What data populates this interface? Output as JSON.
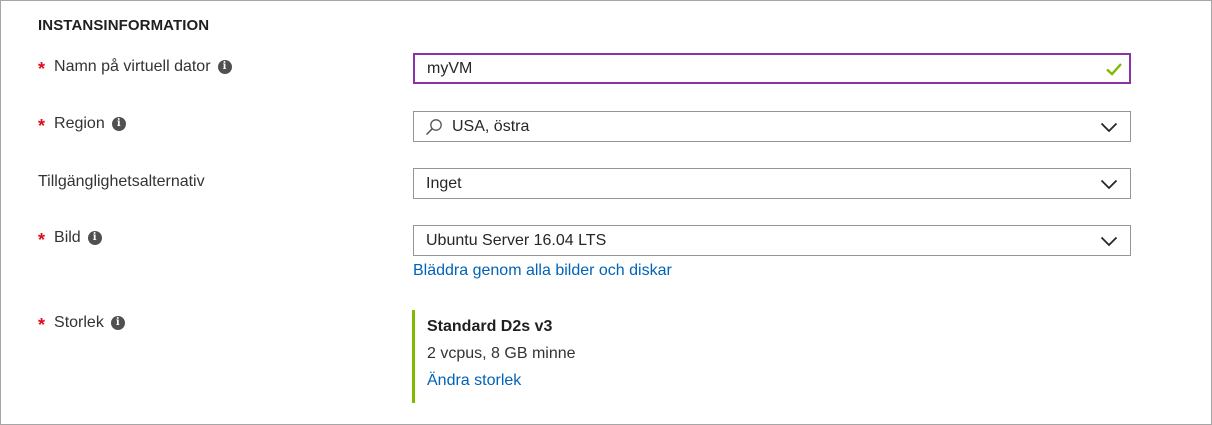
{
  "section": {
    "title": "INSTANSINFORMATION"
  },
  "rows": {
    "vm_name": {
      "required": true,
      "label": "Namn på virtuell dator",
      "value": "myVM",
      "status_icon": "checkmark-icon"
    },
    "region": {
      "required": true,
      "label": "Region",
      "value": "USA, östra"
    },
    "availability": {
      "required": false,
      "label": "Tillgänglighetsalternativ",
      "value": "Inget"
    },
    "image": {
      "required": true,
      "label": "Bild",
      "value": "Ubuntu Server 16.04 LTS",
      "browse_link": "Bläddra genom alla bilder och diskar"
    },
    "size": {
      "required": true,
      "label": "Storlek",
      "name": "Standard D2s v3",
      "spec": "2 vcpus, 8 GB minne",
      "change_link": "Ändra storlek"
    }
  },
  "symbols": {
    "required_marker": "*",
    "info_glyph": "i"
  },
  "colors": {
    "focus_border": "#8a33a8",
    "required": "#e00b1c",
    "link": "#0062b8",
    "valid_check": "#7fba00",
    "size_accent": "#7fba00"
  }
}
